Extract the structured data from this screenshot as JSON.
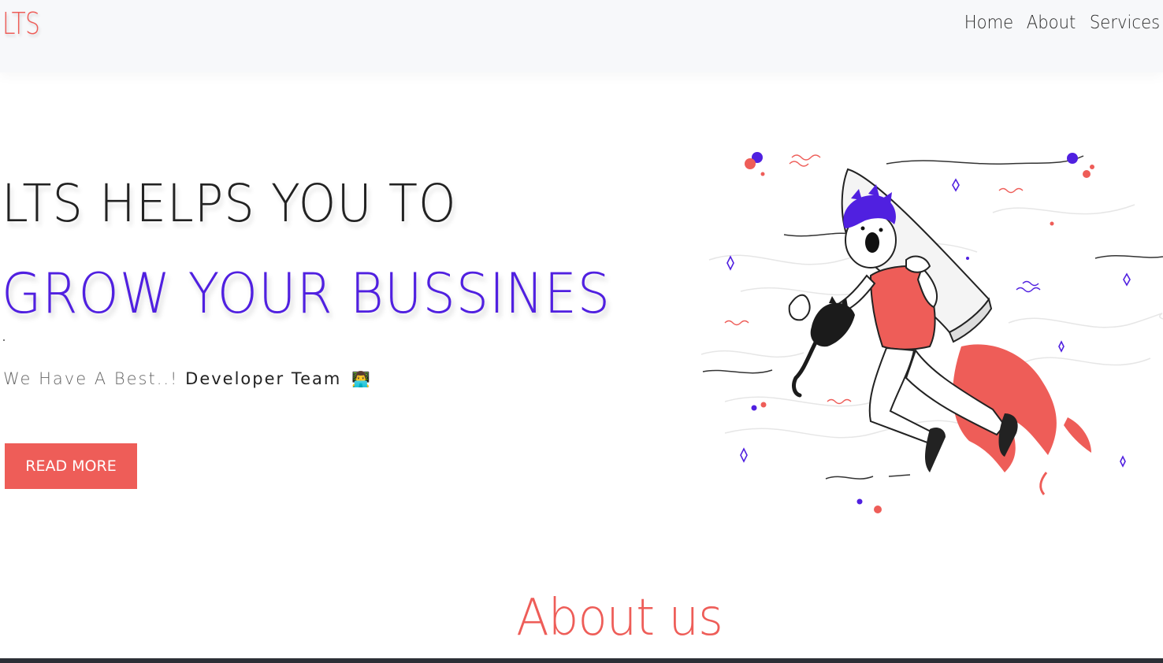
{
  "navbar": {
    "logo": "LTS",
    "links": [
      {
        "label": "Home"
      },
      {
        "label": "About"
      },
      {
        "label": "Services"
      }
    ]
  },
  "hero": {
    "title_line1": "LTS HELPS YOU TO",
    "title_line2": "GROW YOUR BUSSINES",
    "tagline_prefix": "We Have A Best..!",
    "tagline_highlight": "Developer Team",
    "tagline_icon": "👨‍💻",
    "button_label": "READ MORE",
    "illustration": "rocket-boy-with-cat-illustration"
  },
  "about": {
    "heading": "About us"
  },
  "colors": {
    "accent": "#ee5d58",
    "purple": "#5020e0",
    "dark": "#222222",
    "footer": "#2c2f36"
  }
}
